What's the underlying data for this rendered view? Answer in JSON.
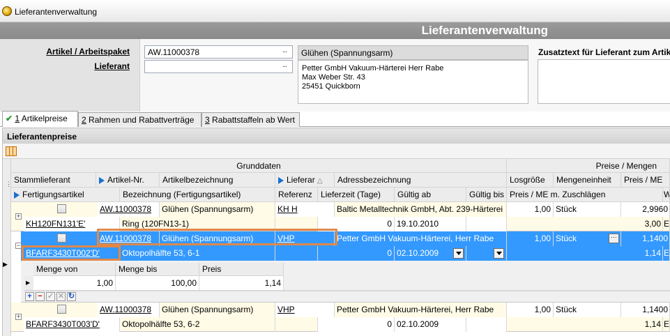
{
  "window": {
    "title": "Lieferantenverwaltung"
  },
  "header": {
    "title": "Lieferantenverwaltung"
  },
  "form": {
    "artikel_label": "Artikel / Arbeitspaket",
    "lieferant_label": "Lieferant",
    "artikel_value": "AW.11000378",
    "lieferant_value": "",
    "ellipsis": "...",
    "artikel_description": "Glühen (Spannungsarm)",
    "address_lines": [
      "Petter GmbH Vakuum-Härterei Herr Rabe",
      "Max Weber Str. 43",
      "25451 Quickborn"
    ],
    "zusatztext_label": "Zusatztext für Lieferant zum Artikel"
  },
  "tabs": [
    {
      "key": "1",
      "label": " Artikelpreise",
      "active": true
    },
    {
      "key": "2",
      "label": " Rahmen und Rabattverträge",
      "active": false
    },
    {
      "key": "3",
      "label": " Rabattstaffeln ab Wert",
      "active": false
    }
  ],
  "panel": {
    "title": "Lieferantenpreise"
  },
  "groups": {
    "grunddaten": "Grunddaten",
    "preise": "Preise / Mengen"
  },
  "columns_row1": [
    "Stammlieferant",
    "Artikel-Nr.",
    "Artikelbezeichnung",
    "Lieferar",
    "Adressbezeichnung",
    "Losgröße",
    "Mengeneinheit",
    "Preis / ME"
  ],
  "columns_row2": [
    "Fertigungsartikel",
    "Bezeichnung (Fertigungsartikel)",
    "Referenz",
    "Lieferzeit (Tage)",
    "Gültig ab",
    "Gültig bis",
    "Preis / ME m. Zuschlägen",
    "W"
  ],
  "rows": [
    {
      "artikel": "AW.11000378",
      "bez": "Glühen (Spannungsarm)",
      "lieferant": "KH H",
      "adresse": "Baltic Metalltechnik GmbH, Abt. 239-Härterei",
      "los": "1,00",
      "me": "Stück",
      "preis": "2,9960",
      "fert": "KH120FN131'E'",
      "fert_bez": "Ring (120FN13-1)",
      "ref": "",
      "lz": "0",
      "ab": "19.10.2010",
      "bis": "",
      "preis_z": "3,00",
      "w": "E"
    },
    {
      "artikel": "AW.11000378",
      "bez": "Glühen (Spannungsarm)",
      "lieferant": "VHP",
      "adresse": "Petter GmbH Vakuum-Härterei, Herr Rabe",
      "los": "1,00",
      "me": "Stück",
      "preis": "1,1400",
      "fert": "BFARF3430T002'D'",
      "fert_bez": "Oktopolhälfte 53, 6-1",
      "ref": "",
      "lz": "0",
      "ab": "02.10.2009",
      "bis": "",
      "preis_z": "1,14",
      "w": "E"
    },
    {
      "artikel": "AW.11000378",
      "bez": "Glühen (Spannungsarm)",
      "lieferant": "VHP",
      "adresse": "Petter GmbH Vakuum-Härterei, Herr Rabe",
      "los": "1,00",
      "me": "Stück",
      "preis": "1,1400",
      "fert": "BFARF3430T003'D'",
      "fert_bez": "Oktopolhälfte 53, 6-2",
      "ref": "",
      "lz": "0",
      "ab": "02.10.2009",
      "bis": "",
      "preis_z": "1,14",
      "w": "E"
    }
  ],
  "subgrid": {
    "headers": [
      "Menge von",
      "Menge bis",
      "Preis"
    ],
    "row": [
      "1,00",
      "100,00",
      "1,14"
    ],
    "nav_buttons": [
      "+",
      "−",
      "✓",
      "✕",
      "↻"
    ]
  }
}
